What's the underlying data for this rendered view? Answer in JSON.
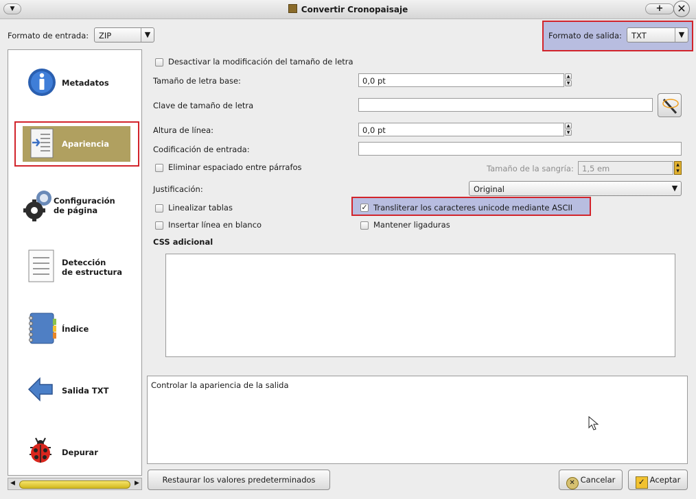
{
  "window": {
    "title": "Convertir Cronopaisaje"
  },
  "header": {
    "input_format_label": "Formato de entrada:",
    "input_format_value": "ZIP",
    "output_format_label": "Formato de salida:",
    "output_format_value": "TXT"
  },
  "sidebar": {
    "items": [
      {
        "label": "Metadatos",
        "icon": "info-icon"
      },
      {
        "label": "Apariencia",
        "icon": "appearance-icon",
        "selected": true
      },
      {
        "label_line1": "Configuración",
        "label_line2": "de página",
        "icon": "gear-icon"
      },
      {
        "label_line1": "Detección",
        "label_line2": "de estructura",
        "icon": "document-icon"
      },
      {
        "label": "Índice",
        "icon": "notebook-icon"
      },
      {
        "label": "Salida TXT",
        "icon": "arrow-left-icon"
      },
      {
        "label": "Depurar",
        "icon": "ladybug-icon"
      }
    ]
  },
  "form": {
    "disable_font_size_label": "Desactivar la modificación del tamaño de letra",
    "base_font_size_label": "Tamaño de letra base:",
    "base_font_size_value": "0,0 pt",
    "font_size_key_label": "Clave de tamaño de letra",
    "font_size_key_value": "",
    "line_height_label": "Altura de línea:",
    "line_height_value": "0,0 pt",
    "input_encoding_label": "Codificación de entrada:",
    "input_encoding_value": "",
    "remove_spacing_label": "Eliminar espaciado entre párrafos",
    "indent_size_label": "Tamaño de la sangría:",
    "indent_size_value": "1,5 em",
    "justification_label": "Justificación:",
    "justification_value": "Original",
    "linearize_tables_label": "Linealizar tablas",
    "transliterate_label": "Transliterar los caracteres unicode mediante ASCII",
    "transliterate_checked": true,
    "insert_blank_line_label": "Insertar línea en blanco",
    "keep_ligatures_label": "Mantener ligaduras",
    "extra_css_label": "CSS adicional",
    "extra_css_value": ""
  },
  "help": {
    "text": "Controlar la apariencia de la salida"
  },
  "buttons": {
    "restore": "Restaurar los valores predeterminados",
    "cancel": "Cancelar",
    "accept": "Aceptar"
  },
  "colors": {
    "selection_bg": "#b0a060",
    "highlight_bg": "#b8bde0",
    "annotation_red": "#d2232a"
  }
}
